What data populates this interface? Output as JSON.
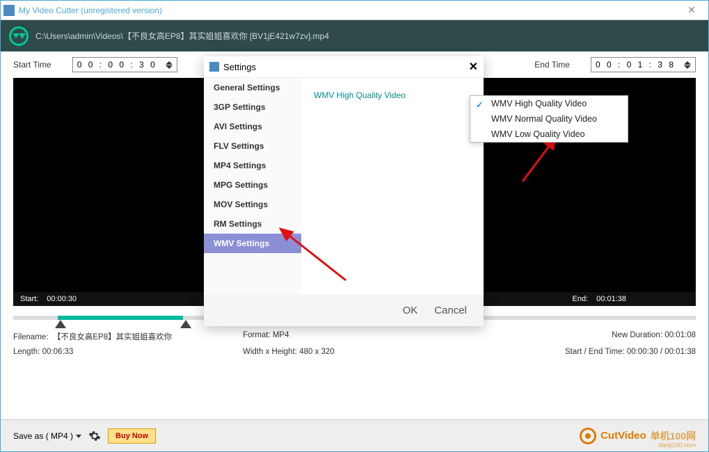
{
  "titlebar": {
    "text": "My Video Cutter (unregistered version)"
  },
  "path": "C:\\Users\\admin\\Videos\\【不良女高EP8】其实姐姐喜欢你 [BV1jE421w7zv].mp4",
  "time": {
    "start_label": "Start Time",
    "start_value": "0 0  :  0 0  :  3 0",
    "end_label": "End Time",
    "end_value": "0 0  :  0 1  :  3 8"
  },
  "video_status": {
    "start_label": "Start:",
    "start_val": "00:00:30",
    "end_label": "End:",
    "end_val": "00:01:38"
  },
  "info": {
    "filename_label": "Filename:",
    "filename_val": "【不良女高EP8】其实姐姐喜欢你",
    "format_label": "Format:",
    "format_val": "MP4",
    "newdur_label": "New Duration:",
    "newdur_val": "00:01:08",
    "length_label": "Length:",
    "length_val": "00:06:33",
    "wh_label": "Width x Height:",
    "wh_val": "480 x 320",
    "startend_label": "Start / End Time:",
    "startend_val": "00:00:30 / 00:01:38"
  },
  "bottom": {
    "saveas": "Save as ( MP4 )",
    "buy": "Buy Now",
    "brand_main": "CutVideo",
    "brand_sub": "danji100.com",
    "overlay": "单机100网"
  },
  "dialog": {
    "title": "Settings",
    "items": [
      "General Settings",
      "3GP Settings",
      "AVI Settings",
      "FLV Settings",
      "MP4 Settings",
      "MPG Settings",
      "MOV Settings",
      "RM Settings",
      "WMV Settings"
    ],
    "active": 8,
    "content": "WMV High Quality Video",
    "ok": "OK",
    "cancel": "Cancel"
  },
  "dropdown": {
    "items": [
      "WMV High Quality Video",
      "WMV Normal Quality Video",
      "WMV Low Quality Video"
    ],
    "selected": 0
  }
}
